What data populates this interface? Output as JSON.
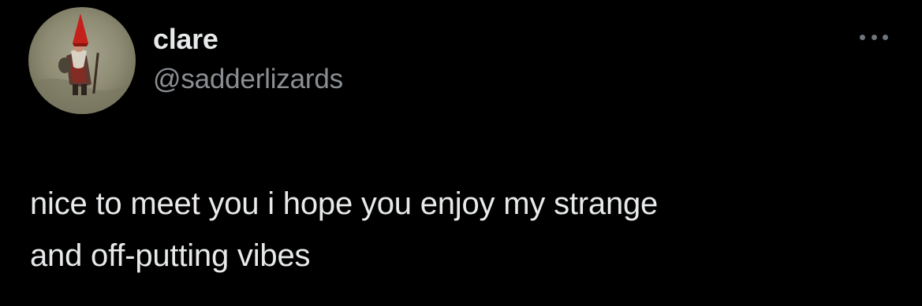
{
  "tweet": {
    "author": {
      "display_name": "clare",
      "handle": "@sadderlizards",
      "avatar_icon": "gnome-avatar"
    },
    "more_icon": "more-horizontal-icon",
    "text_lines": [
      "nice to meet you i hope you enjoy my strange",
      "and off-putting vibes"
    ]
  },
  "colors": {
    "background": "#000000",
    "primary_text": "#e7e9ea",
    "secondary_text": "#8b8f93"
  }
}
